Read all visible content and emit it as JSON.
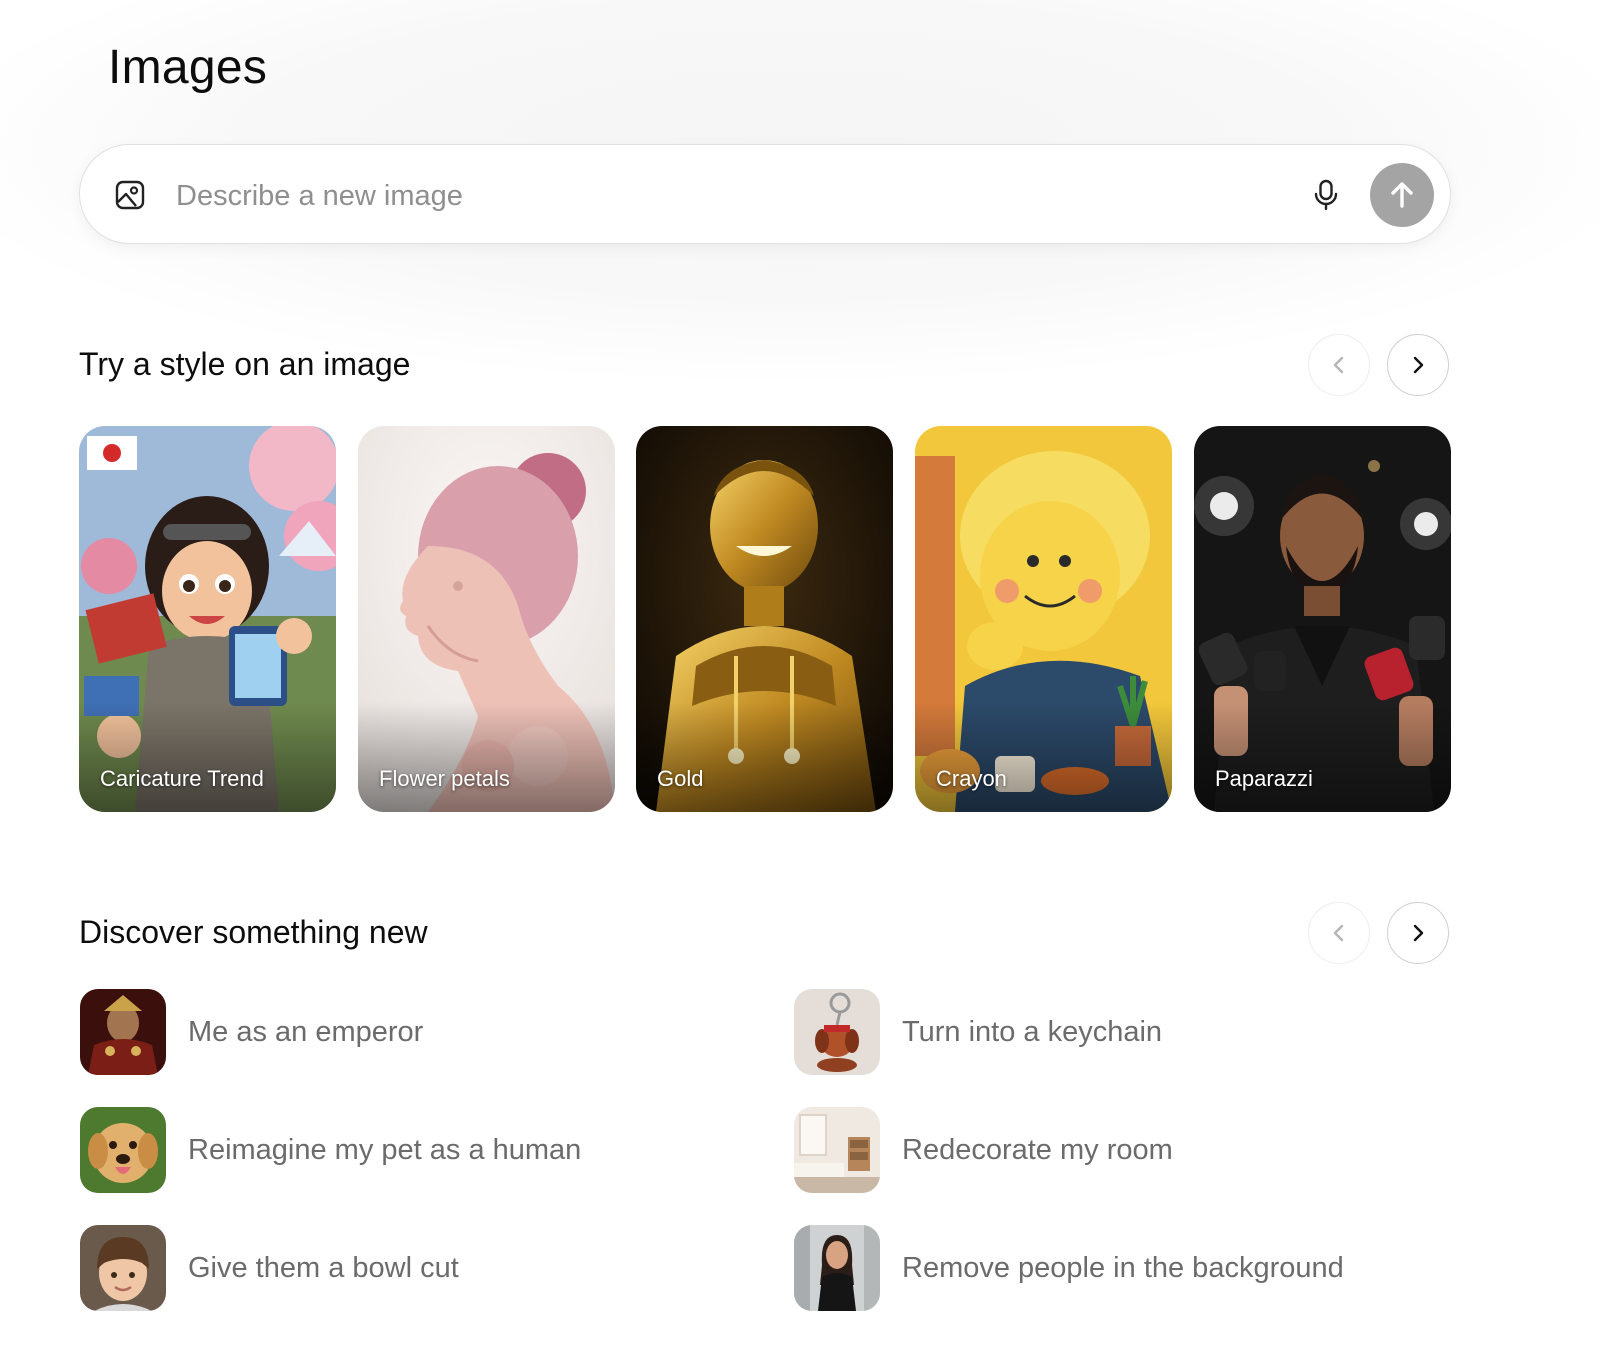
{
  "page": {
    "title": "Images"
  },
  "composer": {
    "placeholder": "Describe a new image",
    "image_icon": "image-upload-icon",
    "mic_icon": "microphone-icon",
    "send_icon": "arrow-up-icon",
    "send_color": "#a4a4a4"
  },
  "styles_section": {
    "title": "Try a style on an image",
    "prev_icon": "chevron-left-icon",
    "next_icon": "chevron-right-icon",
    "cards": [
      {
        "label": "Caricature Trend"
      },
      {
        "label": "Flower petals"
      },
      {
        "label": "Gold"
      },
      {
        "label": "Crayon"
      },
      {
        "label": "Paparazzi"
      }
    ]
  },
  "discover_section": {
    "title": "Discover something new",
    "prev_icon": "chevron-left-icon",
    "next_icon": "chevron-right-icon",
    "items": [
      {
        "label": "Me as an emperor"
      },
      {
        "label": "Turn into a keychain"
      },
      {
        "label": "Reimagine my pet as a human"
      },
      {
        "label": "Redecorate my room"
      },
      {
        "label": "Give them a bowl cut"
      },
      {
        "label": "Remove people in the background"
      }
    ]
  }
}
